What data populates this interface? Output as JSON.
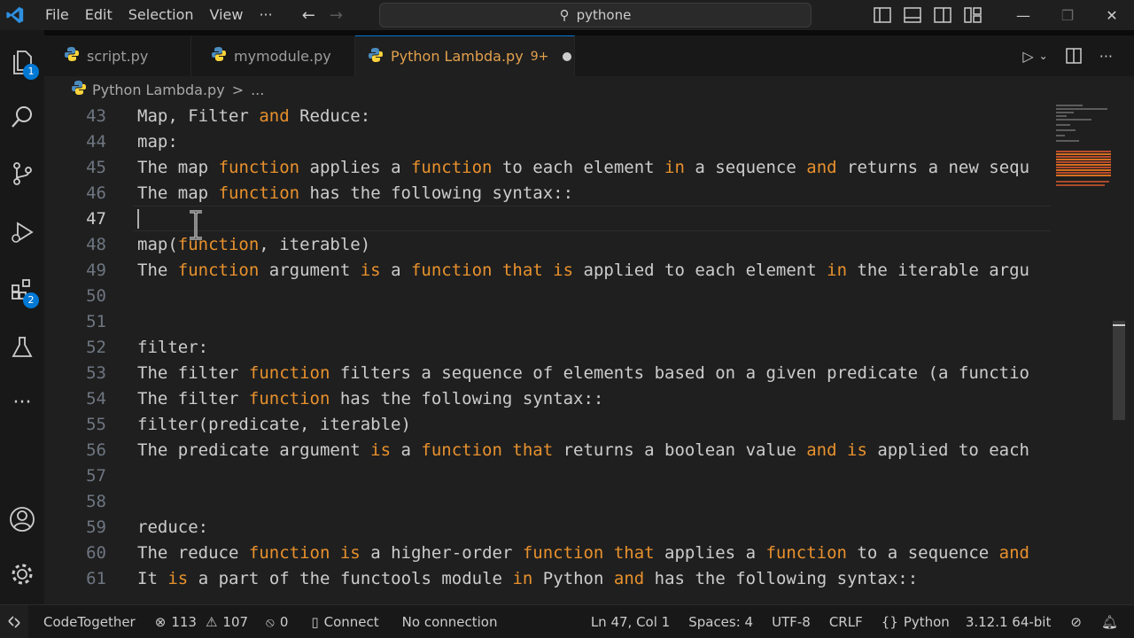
{
  "menu": [
    "File",
    "Edit",
    "Selection",
    "View",
    "···"
  ],
  "search": {
    "text": "pythone"
  },
  "activity_badges": {
    "explorer": "1",
    "extensions": "2"
  },
  "tabs": [
    {
      "label": "script.py"
    },
    {
      "label": "mymodule.py"
    },
    {
      "label": "Python Lambda.py",
      "count": "9+"
    }
  ],
  "breadcrumb": {
    "file": "Python Lambda.py",
    "sep": ">",
    "more": "..."
  },
  "editor": {
    "lines": [
      {
        "n": "43",
        "t": "Map, Filter and Reduce:"
      },
      {
        "n": "44",
        "t": "map:"
      },
      {
        "n": "45",
        "t": "The map function applies a function to each element in a sequence and returns a new sequ"
      },
      {
        "n": "46",
        "t": "The map function has the following syntax::"
      },
      {
        "n": "47",
        "t": ""
      },
      {
        "n": "48",
        "t": "map(function, iterable)"
      },
      {
        "n": "49",
        "t": "The function argument is a function that is applied to each element in the iterable argu"
      },
      {
        "n": "50",
        "t": ""
      },
      {
        "n": "51",
        "t": ""
      },
      {
        "n": "52",
        "t": "filter:"
      },
      {
        "n": "53",
        "t": "The filter function filters a sequence of elements based on a given predicate (a functio"
      },
      {
        "n": "54",
        "t": "The filter function has the following syntax::"
      },
      {
        "n": "55",
        "t": "filter(predicate, iterable)"
      },
      {
        "n": "56",
        "t": "The predicate argument is a function that returns a boolean value and is applied to each"
      },
      {
        "n": "57",
        "t": ""
      },
      {
        "n": "58",
        "t": ""
      },
      {
        "n": "59",
        "t": "reduce:"
      },
      {
        "n": "60",
        "t": "The reduce function is a higher-order function that applies a function to a sequence and"
      },
      {
        "n": "61",
        "t": "It is a part of the functools module in Python and has the following syntax::"
      }
    ]
  },
  "status": {
    "extension": "CodeTogether",
    "errors": "113",
    "warnings": "107",
    "ports": "0",
    "connect": "Connect",
    "connection": "No connection",
    "position": "Ln 47, Col 1",
    "spaces": "Spaces: 4",
    "encoding": "UTF-8",
    "eol": "CRLF",
    "language": "Python",
    "interpreter": "3.12.1 64-bit"
  },
  "colors": {
    "accent": "#0078d4",
    "keyword": "#e8912d",
    "modified_tab": "#e2a04d"
  }
}
